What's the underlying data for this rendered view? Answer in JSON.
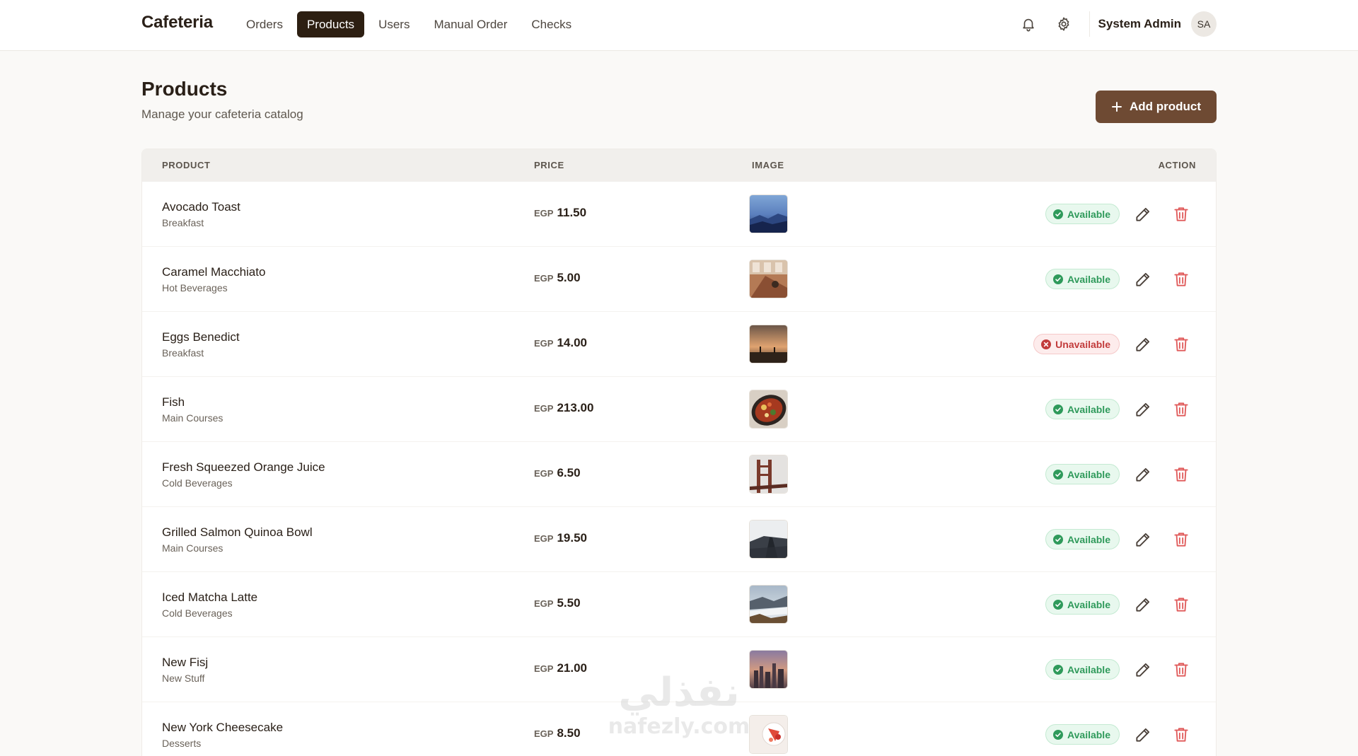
{
  "nav": {
    "brand": "Cafeteria",
    "links": [
      {
        "label": "Orders",
        "active": false
      },
      {
        "label": "Products",
        "active": true
      },
      {
        "label": "Users",
        "active": false
      },
      {
        "label": "Manual Order",
        "active": false
      },
      {
        "label": "Checks",
        "active": false
      }
    ],
    "icons": [
      "bell-icon",
      "gear-icon"
    ],
    "user_name": "System Admin",
    "avatar_initials": "SA"
  },
  "header": {
    "title": "Products",
    "subtitle": "Manage your cafeteria catalog",
    "add_label": "Add product"
  },
  "table": {
    "columns": {
      "product": "PRODUCT",
      "price": "PRICE",
      "image": "IMAGE",
      "action": "ACTION"
    },
    "currency": "EGP",
    "rows": [
      {
        "name": "Avocado Toast",
        "category": "Breakfast",
        "price": "11.50",
        "status": "Available"
      },
      {
        "name": "Caramel Macchiato",
        "category": "Hot Beverages",
        "price": "5.00",
        "status": "Available"
      },
      {
        "name": "Eggs Benedict",
        "category": "Breakfast",
        "price": "14.00",
        "status": "Unavailable"
      },
      {
        "name": "Fish",
        "category": "Main Courses",
        "price": "213.00",
        "status": "Available"
      },
      {
        "name": "Fresh Squeezed Orange Juice",
        "category": "Cold Beverages",
        "price": "6.50",
        "status": "Available"
      },
      {
        "name": "Grilled Salmon Quinoa Bowl",
        "category": "Main Courses",
        "price": "19.50",
        "status": "Available"
      },
      {
        "name": "Iced Matcha Latte",
        "category": "Cold Beverages",
        "price": "5.50",
        "status": "Available"
      },
      {
        "name": "New Fisj",
        "category": "New Stuff",
        "price": "21.00",
        "status": "Available"
      },
      {
        "name": "New York Cheesecake",
        "category": "Desserts",
        "price": "8.50",
        "status": "Available"
      }
    ]
  },
  "watermark": {
    "arabic": "نفذلي",
    "latin": "nafezly.com"
  },
  "colors": {
    "brand_dark": "#2d1f12",
    "accent": "#6e4a33",
    "available": "#2f9a5b",
    "unavailable": "#c23b3b",
    "delete": "#e05a5a"
  }
}
